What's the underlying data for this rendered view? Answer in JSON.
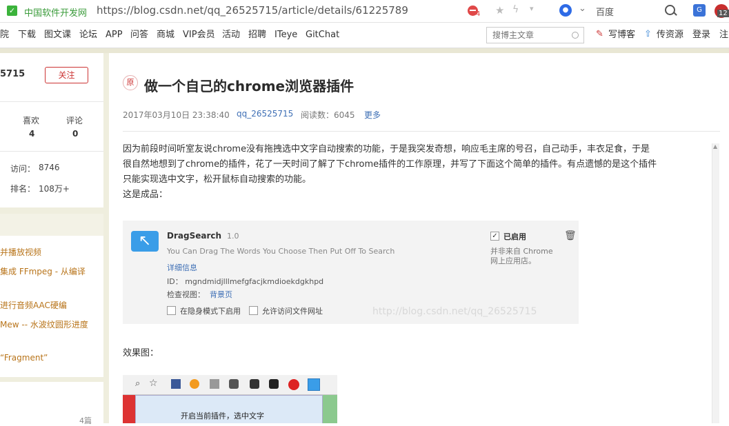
{
  "browser": {
    "site_name": "中国软件开发网",
    "url": "https://blog.csdn.net/qq_26525715/article/details/61225789",
    "badge_count": "4",
    "search_engine": "百度",
    "ext_badge": "12"
  },
  "nav": {
    "items": [
      "院",
      "下载",
      "图文课",
      "论坛",
      "APP",
      "问答",
      "商城",
      "VIP会员",
      "活动",
      "招聘",
      "ITeye",
      "GitChat"
    ],
    "search_placeholder": "搜博主文章",
    "write_blog": "写博客",
    "upload": "传资源",
    "login": "登录",
    "register": "注"
  },
  "sidebar": {
    "user_fragment": "5715",
    "follow_label": "关注",
    "stats": [
      {
        "label": "喜欢",
        "value": "4"
      },
      {
        "label": "评论",
        "value": "0"
      }
    ],
    "visits_label": "访问：",
    "visits_value": "8746",
    "rank_label": "排名：",
    "rank_value": "108万+",
    "articles": [
      "并播放视频",
      "集成 FFmpeg - 从编译",
      "进行音频AAC硬编",
      "Mew -- 水波纹圆形进度",
      "“Fragment”"
    ],
    "count_fragment": "4篇"
  },
  "article": {
    "original_badge": "原",
    "title": "做一个自己的chrome浏览器插件",
    "date": "2017年03月10日 23:38:40",
    "author": "qq_26525715",
    "reads": "阅读数：6045",
    "more": "更多",
    "paragraph": [
      "因为前段时间听室友说chrome没有拖拽选中文字自动搜索的功能，于是我突发奇想，响应毛主席的号召，自己动手，丰衣足食，于是",
      "很自然地想到了chrome的插件，花了一天时间了解了下chrome插件的工作原理，并写了下面这个简单的插件。有点遗憾的是这个插件",
      "只能实现选中文字，松开鼠标自动搜索的功能。"
    ],
    "result_label": "这是成品：",
    "effect_label": "效果图："
  },
  "extension": {
    "name": "DragSearch",
    "version": "1.0",
    "description": "You Can Drag The Words You Choose Then Put Off To Search",
    "details_link": "详细信息",
    "id_text": "ID： mgndmidjlllmefgfacjkmdioekdgkhpd",
    "inspect_label": "检查视图：",
    "background_link": "背景页",
    "incognito_label": "在隐身模式下启用",
    "file_access_label": "允许访问文件网址",
    "enabled_label": "已启用",
    "source_note": [
      "并非来自 Chrome",
      "网上应用店。"
    ],
    "watermark": "http://blog.csdn.net/qq_26525715"
  },
  "screenshot2": {
    "popup_text": "开启当前插件，选中文字"
  }
}
